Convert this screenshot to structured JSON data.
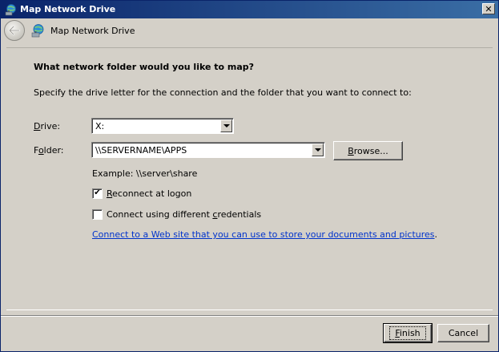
{
  "window": {
    "title": "Map Network Drive",
    "header_title": "Map Network Drive"
  },
  "main": {
    "heading": "What network folder would you like to map?",
    "description": "Specify the drive letter for the connection and the folder that you want to connect to:",
    "drive": {
      "label_pre": "",
      "label_u": "D",
      "label_post": "rive:",
      "value": "X:"
    },
    "folder": {
      "label_pre": "F",
      "label_u": "o",
      "label_post": "lder:",
      "value": "\\\\SERVERNAME\\APPS"
    },
    "browse": {
      "label_u": "B",
      "label_post": "rowse..."
    },
    "example": "Example: \\\\server\\share",
    "reconnect": {
      "label_u": "R",
      "label_post": "econnect at logon",
      "checked": true,
      "check_glyph": "✔"
    },
    "credentials": {
      "label_pre": "Connect using different ",
      "label_u": "c",
      "label_post": "redentials",
      "checked": false
    },
    "web_link": "Connect to a Web site that you can use to store your documents and pictures",
    "web_link_suffix": "."
  },
  "footer": {
    "finish_u": "F",
    "finish_post": "inish",
    "cancel": "Cancel"
  },
  "icons": {
    "app": "network-drive-icon",
    "back": "back-arrow-icon",
    "close": "close-icon",
    "dropdown": "chevron-down-icon"
  },
  "colors": {
    "titlebar_start": "#0a246a",
    "titlebar_end": "#3a6ea5",
    "link": "#0033cc",
    "face": "#d4d0c8"
  }
}
